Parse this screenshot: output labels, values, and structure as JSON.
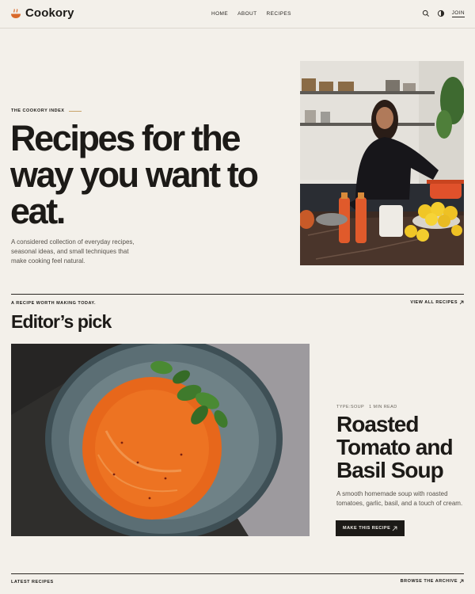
{
  "header": {
    "logo_text": "Cookory",
    "nav": [
      "HOME",
      "ABOUT",
      "RECIPES"
    ],
    "search_icon": "search-icon",
    "theme_icon": "contrast-icon",
    "join_label": "JOIN"
  },
  "hero": {
    "eyebrow": "THE COOKORY INDEX",
    "title": "Recipes for the way you want to eat.",
    "subtitle": "A considered collection of everyday recipes, seasonal ideas, and small techniques that make cooking feel natural."
  },
  "featured": {
    "kicker": "A RECIPE WORTH MAKING TODAY.",
    "view_all": "VIEW ALL RECIPES",
    "section_title": "Editor’s pick",
    "meta_type": "TYPE:SOUP",
    "meta_time": "1 MIN READ",
    "recipe_title": "Roasted Tomato and Basil Soup",
    "recipe_desc": "A smooth homemade soup with roasted tomatoes, garlic, basil, and a touch of cream.",
    "cta": "MAKE THIS RECIPE"
  },
  "latest": {
    "label": "LATEST RECIPES",
    "browse": "BROWSE THE ARCHIVE"
  },
  "colors": {
    "background": "#f3f0ea",
    "text": "#1c1a17",
    "accent": "#c9a36b",
    "logo_orange": "#d9692a"
  }
}
